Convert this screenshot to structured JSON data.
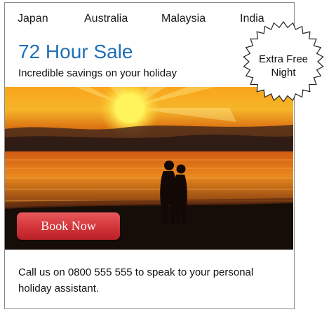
{
  "nav": {
    "items": [
      "Japan",
      "Australia",
      "Malaysia",
      "India"
    ]
  },
  "promo": {
    "title": "72 Hour Sale",
    "subtitle": "Incredible savings on your holiday"
  },
  "badge": {
    "line1": "Extra Free",
    "line2": "Night"
  },
  "hero": {
    "button_label": "Book Now",
    "image_icon": "sunset-couple-beach-photo"
  },
  "contact": {
    "text": "Call us on 0800 555 555 to speak to your personal holiday assistant."
  },
  "colors": {
    "title_blue": "#1f6fb6",
    "button_red": "#d63a3e",
    "border_gray": "#8a8a8a"
  }
}
